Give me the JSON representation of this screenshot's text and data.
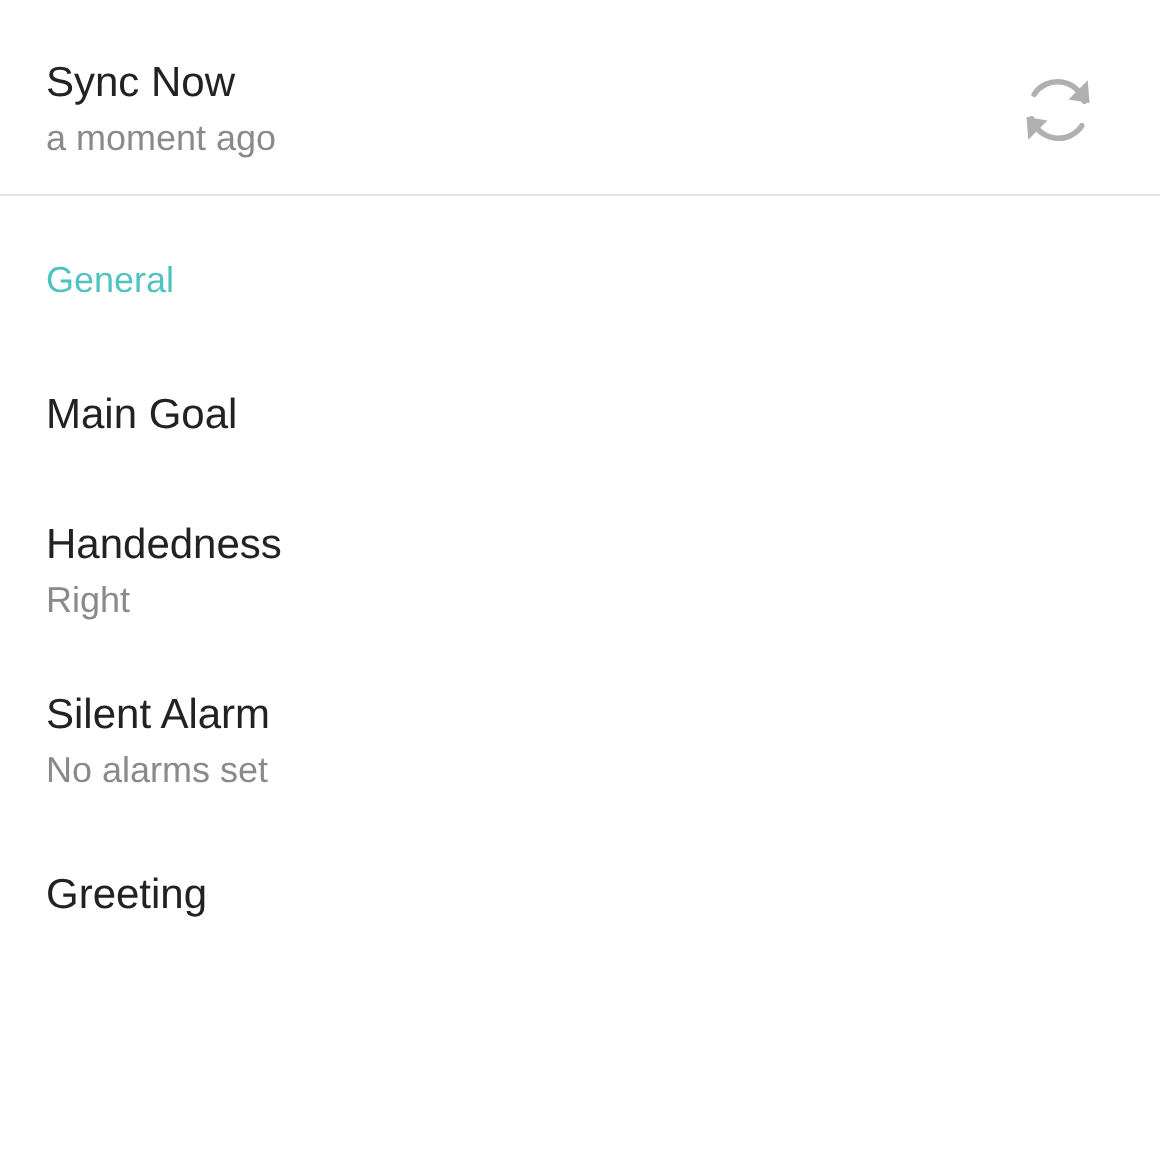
{
  "sections": [
    {
      "items": [
        {
          "kind": "action",
          "title": "Sync Now",
          "summary": "a moment ago"
        }
      ]
    },
    {
      "header": "General",
      "items": [
        {
          "kind": "plain",
          "title": "Main Goal"
        },
        {
          "kind": "plain",
          "title": "Handedness",
          "summary": "Right"
        },
        {
          "kind": "plain",
          "title": "Silent Alarm",
          "summary": "No alarms set"
        },
        {
          "kind": "plain",
          "title": "Greeting"
        }
      ]
    }
  ]
}
